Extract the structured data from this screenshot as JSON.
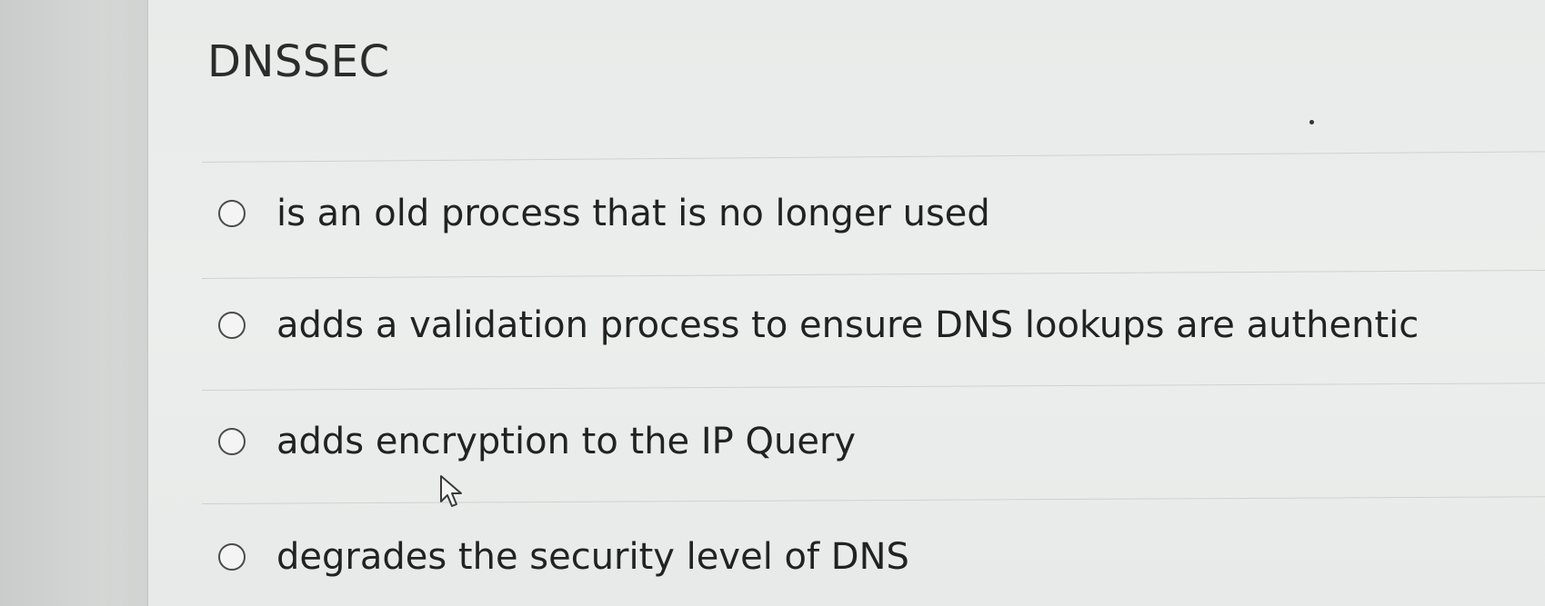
{
  "question": {
    "title": "DNSSEC",
    "options": [
      {
        "label": "is an old process that is no longer used",
        "selected": false
      },
      {
        "label": "adds a validation process to ensure DNS lookups are authentic",
        "selected": false
      },
      {
        "label": "adds encryption to the IP Query",
        "selected": false
      },
      {
        "label": "degrades the security level of DNS",
        "selected": false
      }
    ]
  },
  "icons": {
    "radio": "radio-unselected-icon",
    "pointer": "mouse-pointer-icon"
  },
  "colors": {
    "text": "#222222",
    "radio_border": "#4a4a4a",
    "divider": "#cfd2d0",
    "background": "#eceeed"
  }
}
